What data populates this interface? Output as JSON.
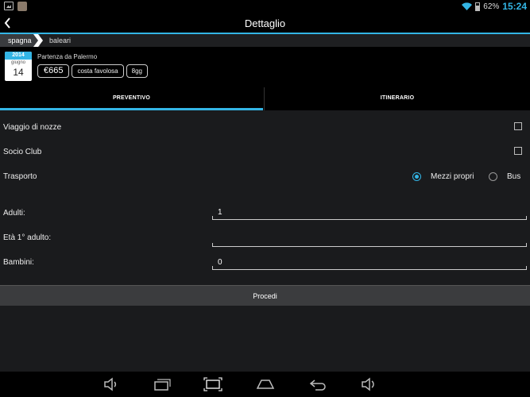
{
  "status_bar": {
    "battery": "62%",
    "time": "15:24",
    "icons": [
      "image-icon",
      "avatar-icon",
      "wifi-icon",
      "battery-icon"
    ]
  },
  "action_bar": {
    "title": "Dettaglio",
    "back_icon": "chevron-left-icon"
  },
  "breadcrumb": {
    "items": [
      "spagna",
      "baleari"
    ]
  },
  "trip": {
    "calendar": {
      "year": "2014",
      "month": "giugno",
      "day": "14"
    },
    "departure": "Partenza da Palermo",
    "tags": [
      "€665",
      "costa favolosa",
      "8gg"
    ]
  },
  "tabs": [
    {
      "label": "PREVENTIVO",
      "selected": true
    },
    {
      "label": "ITINERARIO",
      "selected": false
    }
  ],
  "form": {
    "honeymoon_label": "Viaggio di nozze",
    "honeymoon_checked": false,
    "club_label": "Socio Club",
    "club_checked": false,
    "transport_label": "Trasporto",
    "transport_options": [
      "Mezzi propri",
      "Bus"
    ],
    "transport_selected": "Mezzi propri",
    "adults_label": "Adulti:",
    "adults_value": "1",
    "first_adult_age_label": "Età 1° adulto:",
    "first_adult_age_value": "",
    "children_label": "Bambini:",
    "children_value": "0"
  },
  "proceed_button": "Procedi",
  "navigation_bar": {
    "icons": [
      "volume-down-icon",
      "recent-apps-icon",
      "screenshot-icon",
      "home-icon",
      "back-icon",
      "volume-up-icon"
    ]
  },
  "colors": {
    "accent": "#33b5e5",
    "background": "#1a1b1d"
  }
}
